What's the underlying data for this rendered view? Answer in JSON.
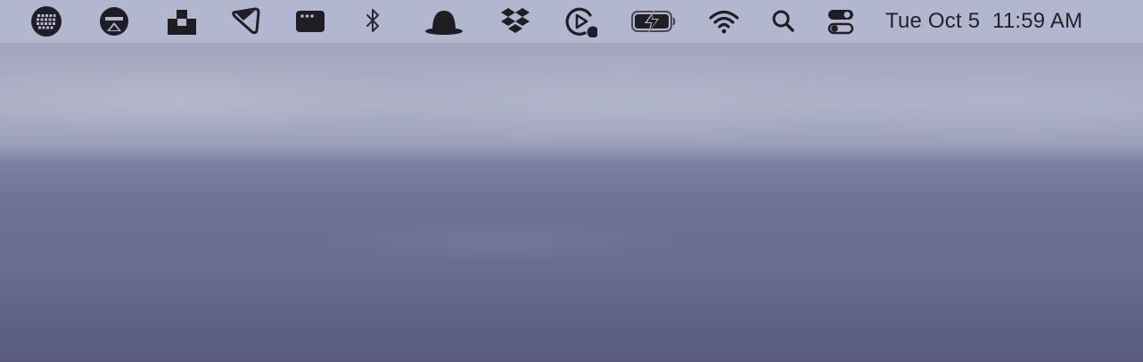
{
  "menubar": {
    "status_items": [
      {
        "icon": "keyboard-grid-icon"
      },
      {
        "icon": "airplay-display-icon"
      },
      {
        "icon": "unsplash-icon"
      },
      {
        "icon": "pen-tag-icon"
      },
      {
        "icon": "app-window-icon"
      },
      {
        "icon": "bluetooth-icon"
      },
      {
        "icon": "bowler-hat-icon"
      },
      {
        "icon": "dropbox-icon"
      },
      {
        "icon": "screen-recorder-icon"
      },
      {
        "icon": "battery-charging-icon"
      },
      {
        "icon": "wifi-icon"
      },
      {
        "icon": "spotlight-search-icon"
      },
      {
        "icon": "control-center-icon"
      }
    ],
    "date": "Tue Oct 5",
    "time": "11:59 AM"
  },
  "colors": {
    "menubar_bg": "#b3b6cf",
    "icon_color": "#1e1e24"
  }
}
